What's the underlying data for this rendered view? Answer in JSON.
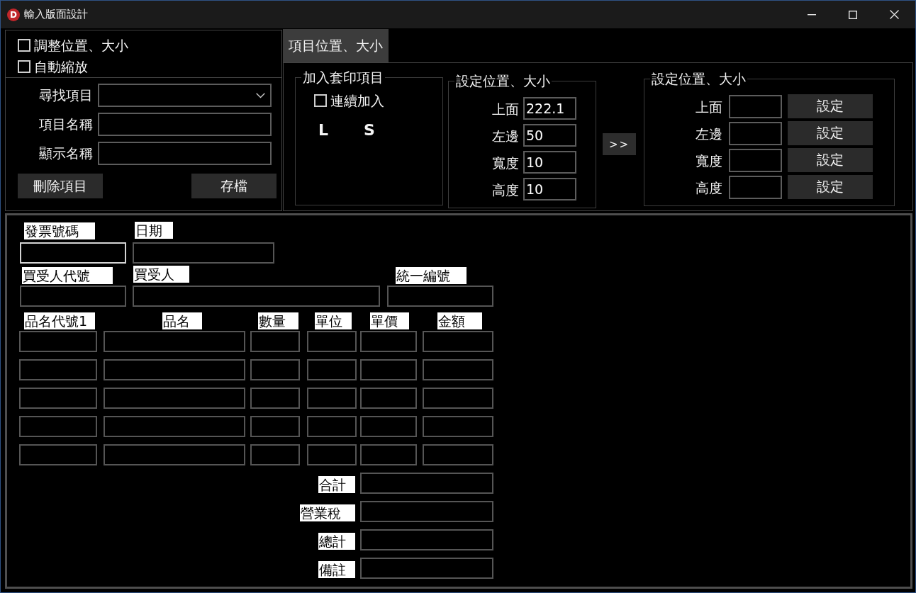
{
  "window": {
    "title": "輸入版面設計",
    "logo_letter": "D"
  },
  "options": [
    {
      "label": "調整位置、大小",
      "checked": false
    },
    {
      "label": "自動縮放",
      "checked": false
    }
  ],
  "item_form": {
    "fields": [
      {
        "kind": "dropdown",
        "label": "尋找項目"
      },
      {
        "kind": "text",
        "label": "項目名稱"
      },
      {
        "kind": "text",
        "label": "顯示名稱"
      }
    ],
    "buttons": [
      "刪除項目",
      "存檔"
    ]
  },
  "tabs": [
    {
      "label": "項目位置、大小",
      "selected": true
    }
  ],
  "add_group": {
    "title": "加入套印項目",
    "continuous": {
      "label": "連續加入",
      "checked": false
    },
    "sizes": [
      "L",
      "S"
    ]
  },
  "position_group": {
    "title": "設定位置、大小",
    "fields": [
      {
        "label": "上面",
        "value": "222.1"
      },
      {
        "label": "左邊",
        "value": "50"
      },
      {
        "label": "寬度",
        "value": "10"
      },
      {
        "label": "高度",
        "value": "10"
      }
    ]
  },
  "transfer_button": ">>",
  "set_group": {
    "title": "設定位置、大小",
    "rows": [
      {
        "label": "上面",
        "button": "設定"
      },
      {
        "label": "左邊",
        "button": "設定"
      },
      {
        "label": "寬度",
        "button": "設定"
      },
      {
        "label": "高度",
        "button": "設定"
      }
    ]
  },
  "canvas": {
    "header_items": [
      {
        "label": "發票號碼",
        "selected": true
      },
      {
        "label": "日期",
        "selected": false
      },
      {
        "label": "買受人代號",
        "selected": false
      },
      {
        "label": "買受人",
        "selected": false
      },
      {
        "label": "統一編號",
        "selected": false
      }
    ],
    "line_columns": [
      {
        "label": "品名代號1"
      },
      {
        "label": "品名"
      },
      {
        "label": "數量"
      },
      {
        "label": "單位"
      },
      {
        "label": "單價"
      },
      {
        "label": "金額"
      }
    ],
    "line_rows": [
      {
        "cells": [
          {
            "selected": false
          },
          {
            "selected": false
          },
          {
            "selected": false
          },
          {
            "selected": false
          },
          {
            "selected": false
          },
          {
            "selected": false
          }
        ]
      },
      {
        "cells": [
          {
            "selected": false
          },
          {
            "selected": false
          },
          {
            "selected": false
          },
          {
            "selected": false
          },
          {
            "selected": false
          },
          {
            "selected": false
          }
        ]
      },
      {
        "cells": [
          {
            "selected": false
          },
          {
            "selected": false
          },
          {
            "selected": false
          },
          {
            "selected": false
          },
          {
            "selected": false
          },
          {
            "selected": false
          }
        ]
      },
      {
        "cells": [
          {
            "selected": false
          },
          {
            "selected": false
          },
          {
            "selected": false
          },
          {
            "selected": false
          },
          {
            "selected": false
          },
          {
            "selected": false
          }
        ]
      },
      {
        "cells": [
          {
            "selected": false
          },
          {
            "selected": false
          },
          {
            "selected": false
          },
          {
            "selected": false
          },
          {
            "selected": false
          },
          {
            "selected": false
          }
        ]
      }
    ],
    "totals": [
      {
        "label": "合計",
        "selected": false
      },
      {
        "label": "營業稅",
        "selected": false
      },
      {
        "label": "總計",
        "selected": false
      },
      {
        "label": "備註",
        "selected": false
      }
    ]
  }
}
